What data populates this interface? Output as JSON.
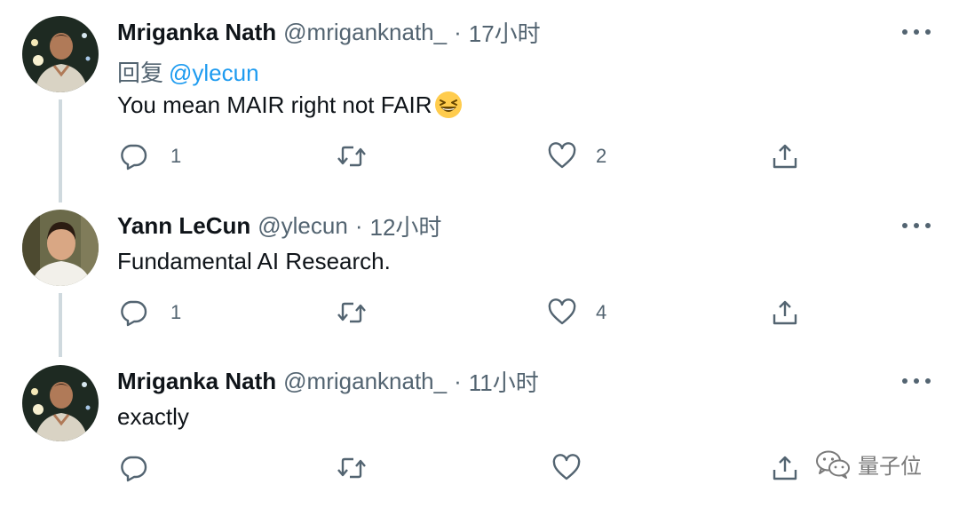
{
  "tweets": [
    {
      "name": "Mriganka Nath",
      "handle": "@mriganknath_",
      "dot": "·",
      "time": "17小时",
      "reply_label": "回复",
      "reply_mention": "@ylecun",
      "text": "You mean MAIR right not FAIR",
      "emoji": "grinning-squinting-face-emoji",
      "replies": "1",
      "retweets": "",
      "likes": "2"
    },
    {
      "name": "Yann LeCun",
      "handle": "@ylecun",
      "dot": "·",
      "time": "12小时",
      "text": "Fundamental AI Research.",
      "replies": "1",
      "retweets": "",
      "likes": "4"
    },
    {
      "name": "Mriganka Nath",
      "handle": "@mriganknath_",
      "dot": "·",
      "time": "11小时",
      "text": "exactly",
      "replies": "",
      "retweets": "",
      "likes": ""
    }
  ],
  "watermark": {
    "text": "量子位",
    "icon": "wechat-icon"
  },
  "colors": {
    "text_primary": "#0f1419",
    "text_secondary": "#536471",
    "mention": "#1d9bf0",
    "thread_line": "#cfd9de"
  }
}
